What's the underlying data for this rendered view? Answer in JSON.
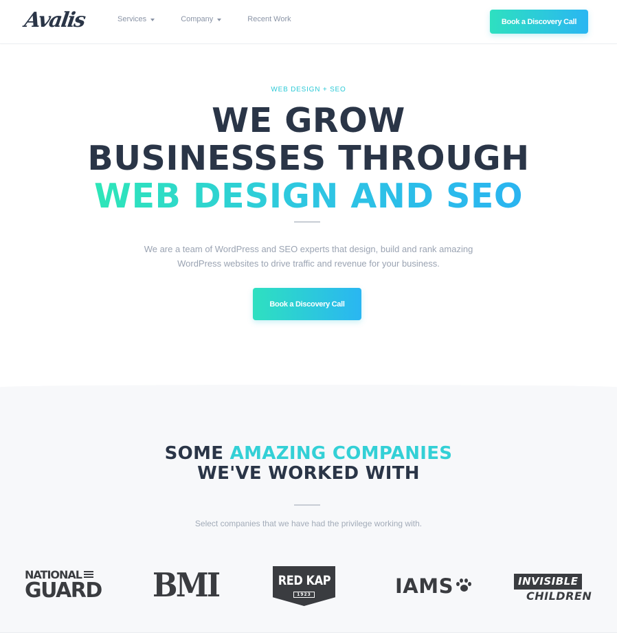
{
  "header": {
    "logo": "Avalis",
    "nav": [
      {
        "label": "Services",
        "dropdown": true
      },
      {
        "label": "Company",
        "dropdown": true
      },
      {
        "label": "Recent Work",
        "dropdown": false
      }
    ],
    "cta_label": "Book a Discovery Call"
  },
  "hero": {
    "eyebrow": "WEB DESIGN + SEO",
    "headline_line1": "WE GROW",
    "headline_line2": "BUSINESSES THROUGH",
    "headline_line3": "WEB DESIGN AND SEO",
    "subtext": "We are a team of WordPress and SEO experts that design, build and rank amazing WordPress websites to drive traffic and revenue for your business.",
    "cta_label": "Book a Discovery Call"
  },
  "clients": {
    "title_part1": "SOME ",
    "title_accent": "AMAZING COMPANIES",
    "title_line2": "WE'VE WORKED WITH",
    "subtitle": "Select companies that we have had the privilege working with.",
    "logos": {
      "national_guard_l1": "NATIONAL",
      "national_guard_l2": "GUARD",
      "bmi": "BMI",
      "redkap": "RED KAP",
      "redkap_year": "1923",
      "iams": "IAMS",
      "invisible_children_l1": "INVISIBLE",
      "invisible_children_l2": "CHILDREN"
    }
  },
  "colors": {
    "accent_start": "#2ee0c0",
    "accent_end": "#2ab6f2",
    "heading": "#2a3547",
    "muted": "#9aa3b2"
  }
}
